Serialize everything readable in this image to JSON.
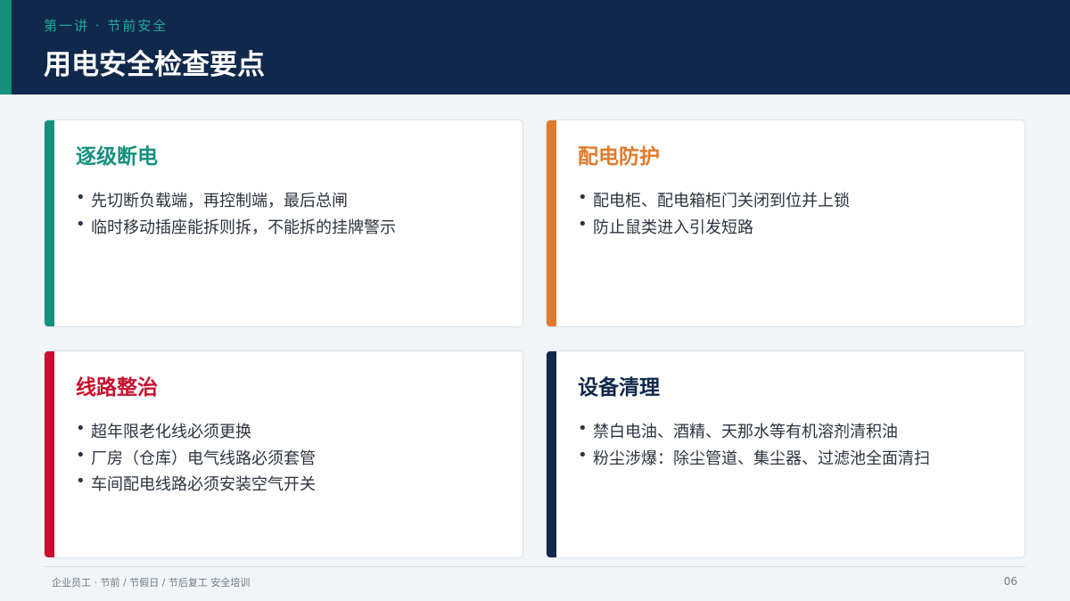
{
  "colors": {
    "header_bg": "#10284b",
    "accent_teal": "#15907f",
    "accent_orange": "#e07b2d",
    "accent_red": "#c8102e",
    "accent_navy": "#10284b"
  },
  "header": {
    "kicker": "第一讲 · 节前安全",
    "title": "用电安全检查要点"
  },
  "cards": [
    {
      "title": "逐级断电",
      "color": "#15907f",
      "items": [
        "先切断负载端，再控制端，最后总闸",
        "临时移动插座能拆则拆，不能拆的挂牌警示"
      ]
    },
    {
      "title": "配电防护",
      "color": "#e07b2d",
      "items": [
        "配电柜、配电箱柜门关闭到位并上锁",
        "防止鼠类进入引发短路"
      ]
    },
    {
      "title": "线路整治",
      "color": "#c8102e",
      "items": [
        "超年限老化线必须更换",
        "厂房（仓库）电气线路必须套管",
        "车间配电线路必须安装空气开关"
      ]
    },
    {
      "title": "设备清理",
      "color": "#10284b",
      "items": [
        "禁白电油、酒精、天那水等有机溶剂清积油",
        "粉尘涉爆：除尘管道、集尘器、过滤池全面清扫"
      ]
    }
  ],
  "footer": {
    "text": "企业员工 · 节前 / 节假日 / 节后复工 安全培训",
    "page_number": "06"
  }
}
